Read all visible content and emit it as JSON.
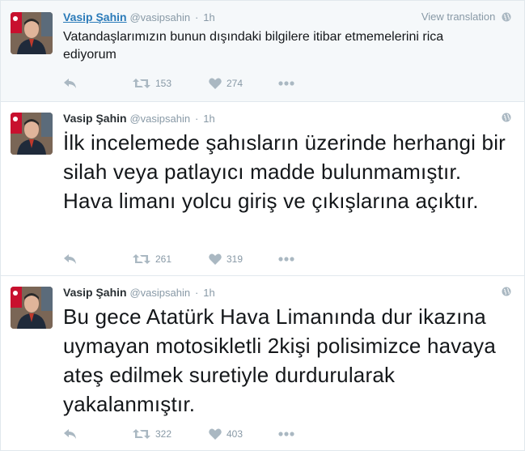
{
  "tweets": [
    {
      "author": "Vasip Şahin",
      "handle": "@vasipsahin",
      "separator": "·",
      "time": "1h",
      "translate_label": "View translation",
      "text": "Vatandaşlarımızın bunun dışındaki bilgilere itibar etmemelerini rica ediyorum",
      "retweets": "153",
      "likes": "274"
    },
    {
      "author": "Vasip Şahin",
      "handle": "@vasipsahin",
      "separator": "·",
      "time": "1h",
      "text": "İlk incelemede şahısların üzerinde herhangi bir silah veya patlayıcı madde bulunmamıştır. Hava limanı yolcu giriş ve çıkışlarına açıktır.",
      "retweets": "261",
      "likes": "319"
    },
    {
      "author": "Vasip Şahin",
      "handle": "@vasipsahin",
      "separator": "·",
      "time": "1h",
      "text": "Bu gece Atatürk Hava Limanında dur ikazına uymayan motosikletli 2kişi polisimizce havaya ateş edilmek suretiyle durdurularak yakalanmıştır.",
      "retweets": "322",
      "likes": "403"
    }
  ],
  "icons": {
    "reply": "reply-icon",
    "retweet": "retweet-icon",
    "like": "heart-icon",
    "more": "more-icon",
    "globe": "globe-icon"
  },
  "colors": {
    "link": "#2b7bb9",
    "muted": "#8899a6",
    "icon": "#aab8c2",
    "highlight_bg": "#f5f8fa"
  }
}
